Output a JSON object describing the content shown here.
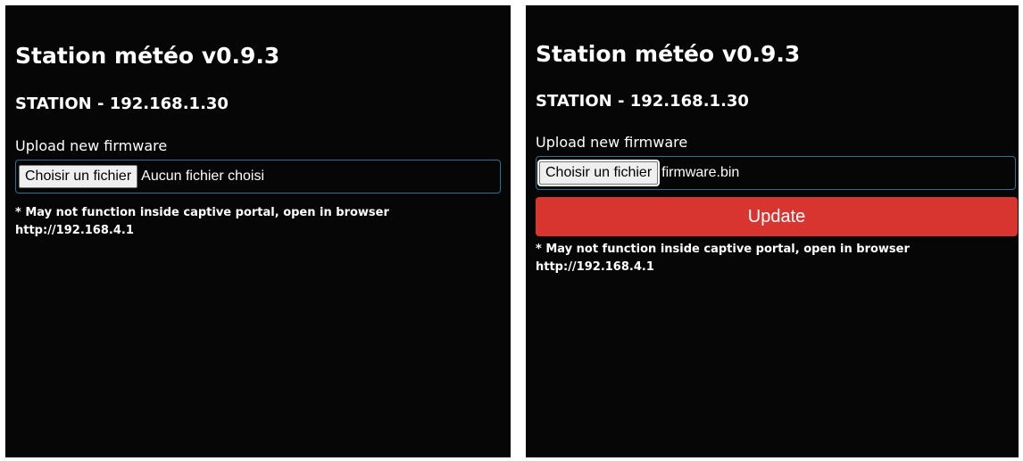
{
  "panels": [
    {
      "title": "Station météo v0.9.3",
      "subtitle": "STATION - 192.168.1.30",
      "upload_label": "Upload new firmware",
      "file_button_label": "Choisir un fichier",
      "file_status": "Aucun fichier choisi",
      "note_line1": "* May not function inside captive portal, open in browser",
      "note_line2": "http://192.168.4.1"
    },
    {
      "title": "Station météo v0.9.3",
      "subtitle": "STATION - 192.168.1.30",
      "upload_label": "Upload new firmware",
      "file_button_label": "Choisir un fichier",
      "file_status": "firmware.bin",
      "update_button_label": "Update",
      "note_line1": "* May not function inside captive portal, open in browser",
      "note_line2": "http://192.168.4.1"
    }
  ],
  "colors": {
    "background": "#060606",
    "accent_border": "#2f6f8f",
    "update_button": "#d93530"
  }
}
